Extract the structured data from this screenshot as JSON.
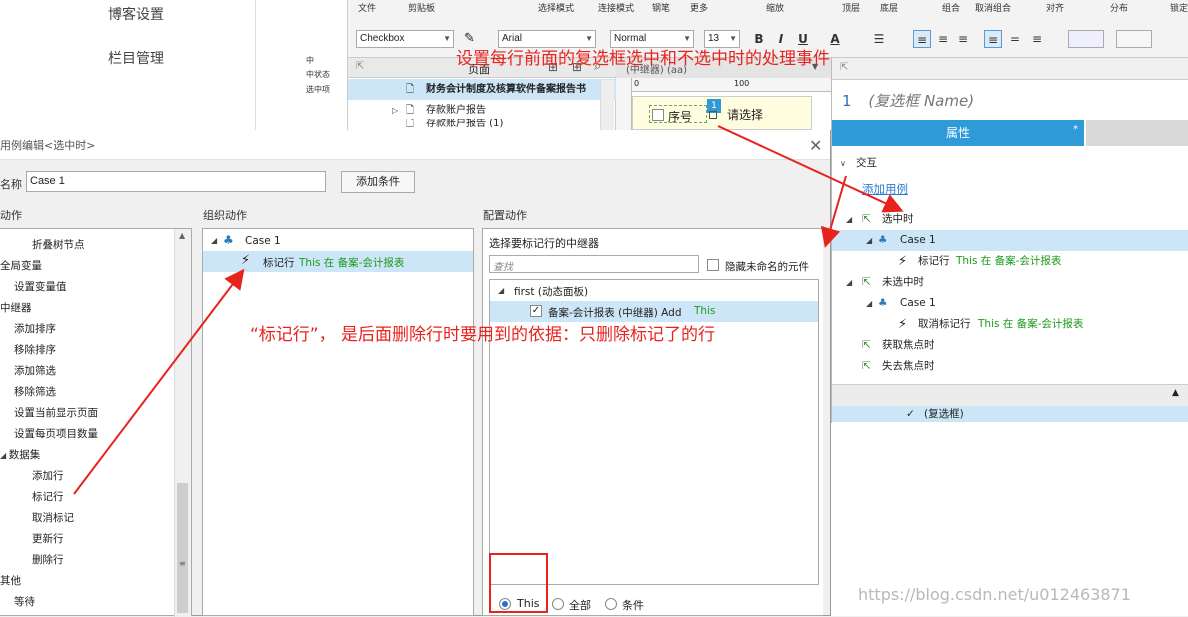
{
  "blog_side": {
    "items": [
      "博客设置",
      "栏目管理"
    ]
  },
  "left_gap": {
    "lines": [
      "中",
      "中状态",
      "选中项"
    ]
  },
  "toolbar": {
    "labels": [
      "文件",
      "剪贴板",
      "选择模式",
      "连接模式",
      "钢笔",
      "更多",
      "缩放",
      "顶层",
      "底层",
      "组合",
      "取消组合",
      "对齐",
      "分布",
      "锁定"
    ],
    "widget_type": "Checkbox",
    "font": "Arial",
    "style": "Normal",
    "size": "13",
    "bold": "B",
    "italic": "I",
    "underline": "U",
    "color_a": "A"
  },
  "pages_panel": {
    "header": "页面",
    "rows": [
      "财务会计制度及核算软件备案报告书",
      "存款账户报告",
      "存款账户报告 (1)"
    ]
  },
  "canvas": {
    "tab_label": "(中继器) (aa)",
    "ruler_0": "0",
    "ruler_100": "100",
    "cell_seq": "序号",
    "badge": "1",
    "cell_select": "请选择"
  },
  "right_panel": {
    "index": "1",
    "name_placeholder": "(复选框 Name)",
    "tab_properties": "属性",
    "tab_star": "*",
    "section_interaction": "交互",
    "add_case": "添加用例",
    "event_checked": "选中时",
    "case1": "Case 1",
    "action_mark": "标记行",
    "action_unmark": "取消标记行",
    "this_in": "This 在 备案-会计报表",
    "event_unchecked": "未选中时",
    "event_focus": "获取焦点时",
    "event_blur": "失去焦点时",
    "bottom_item": "(复选框)"
  },
  "dialog": {
    "title": "用例编辑<选中时>",
    "case_name_label": "名称",
    "case_name_value": "Case 1",
    "add_condition": "添加条件",
    "actions_header": "动作",
    "organize_header": "组织动作",
    "configure_header": "配置动作",
    "actions_list": [
      {
        "label": "折叠树节点",
        "indent": 2
      },
      {
        "label": "全局变量",
        "indent": 0
      },
      {
        "label": "设置变量值",
        "indent": 1
      },
      {
        "label": "中继器",
        "indent": 0
      },
      {
        "label": "添加排序",
        "indent": 1
      },
      {
        "label": "移除排序",
        "indent": 1
      },
      {
        "label": "添加筛选",
        "indent": 1
      },
      {
        "label": "移除筛选",
        "indent": 1
      },
      {
        "label": "设置当前显示页面",
        "indent": 1
      },
      {
        "label": "设置每页项目数量",
        "indent": 1
      },
      {
        "label": "数据集",
        "indent": 0
      },
      {
        "label": "添加行",
        "indent": 2
      },
      {
        "label": "标记行",
        "indent": 2
      },
      {
        "label": "取消标记",
        "indent": 2
      },
      {
        "label": "更新行",
        "indent": 2
      },
      {
        "label": "删除行",
        "indent": 2
      },
      {
        "label": "其他",
        "indent": 0
      },
      {
        "label": "等待",
        "indent": 1
      }
    ],
    "organize_case": "Case 1",
    "organize_action": "标记行",
    "organize_action_detail": "This 在 备案-会计报表",
    "configure_title": "选择要标记行的中继器",
    "search_placeholder": "查找",
    "hide_unnamed": "隐藏未命名的元件",
    "tree_group": "first (动态面板)",
    "tree_item": "备案-会计报表 (中继器) Add",
    "tree_item_this": "This",
    "radio_this": "This",
    "radio_all": "全部",
    "radio_cond": "条件"
  },
  "annotations": {
    "top": "设置每行前面的复选框选中和不选中时的处理事件",
    "middle": "“标记行”， 是后面删除行时要用到的依据：只删除标记了的行"
  },
  "watermark": "https://blog.csdn.net/u012463871"
}
